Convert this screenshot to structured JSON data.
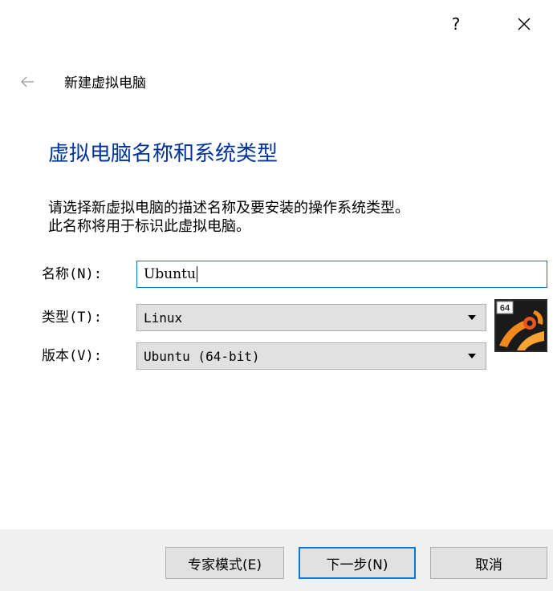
{
  "window": {
    "help_label": "?",
    "close_icon": "close-icon"
  },
  "header": {
    "back_icon": "back-arrow-icon",
    "title": "新建虚拟电脑"
  },
  "page": {
    "heading": "虚拟电脑名称和系统类型",
    "description_line1": "请选择新虚拟电脑的描述名称及要安装的操作系统类型。",
    "description_line2": "此名称将用于标识此虚拟电脑。"
  },
  "form": {
    "name_label": "名称(N):",
    "name_value": "Ubuntu",
    "type_label": "类型(T):",
    "type_value": "Linux",
    "version_label": "版本(V):",
    "version_value": "Ubuntu (64-bit)",
    "os_logo_badge": "64"
  },
  "footer": {
    "expert_mode_label": "专家模式(E)",
    "next_label": "下一步(N)",
    "cancel_label": "取消"
  },
  "colors": {
    "heading": "#003399",
    "focus_border": "#0078d7",
    "button_bg": "#e1e1e1",
    "footer_bg": "#f0f0f0"
  }
}
